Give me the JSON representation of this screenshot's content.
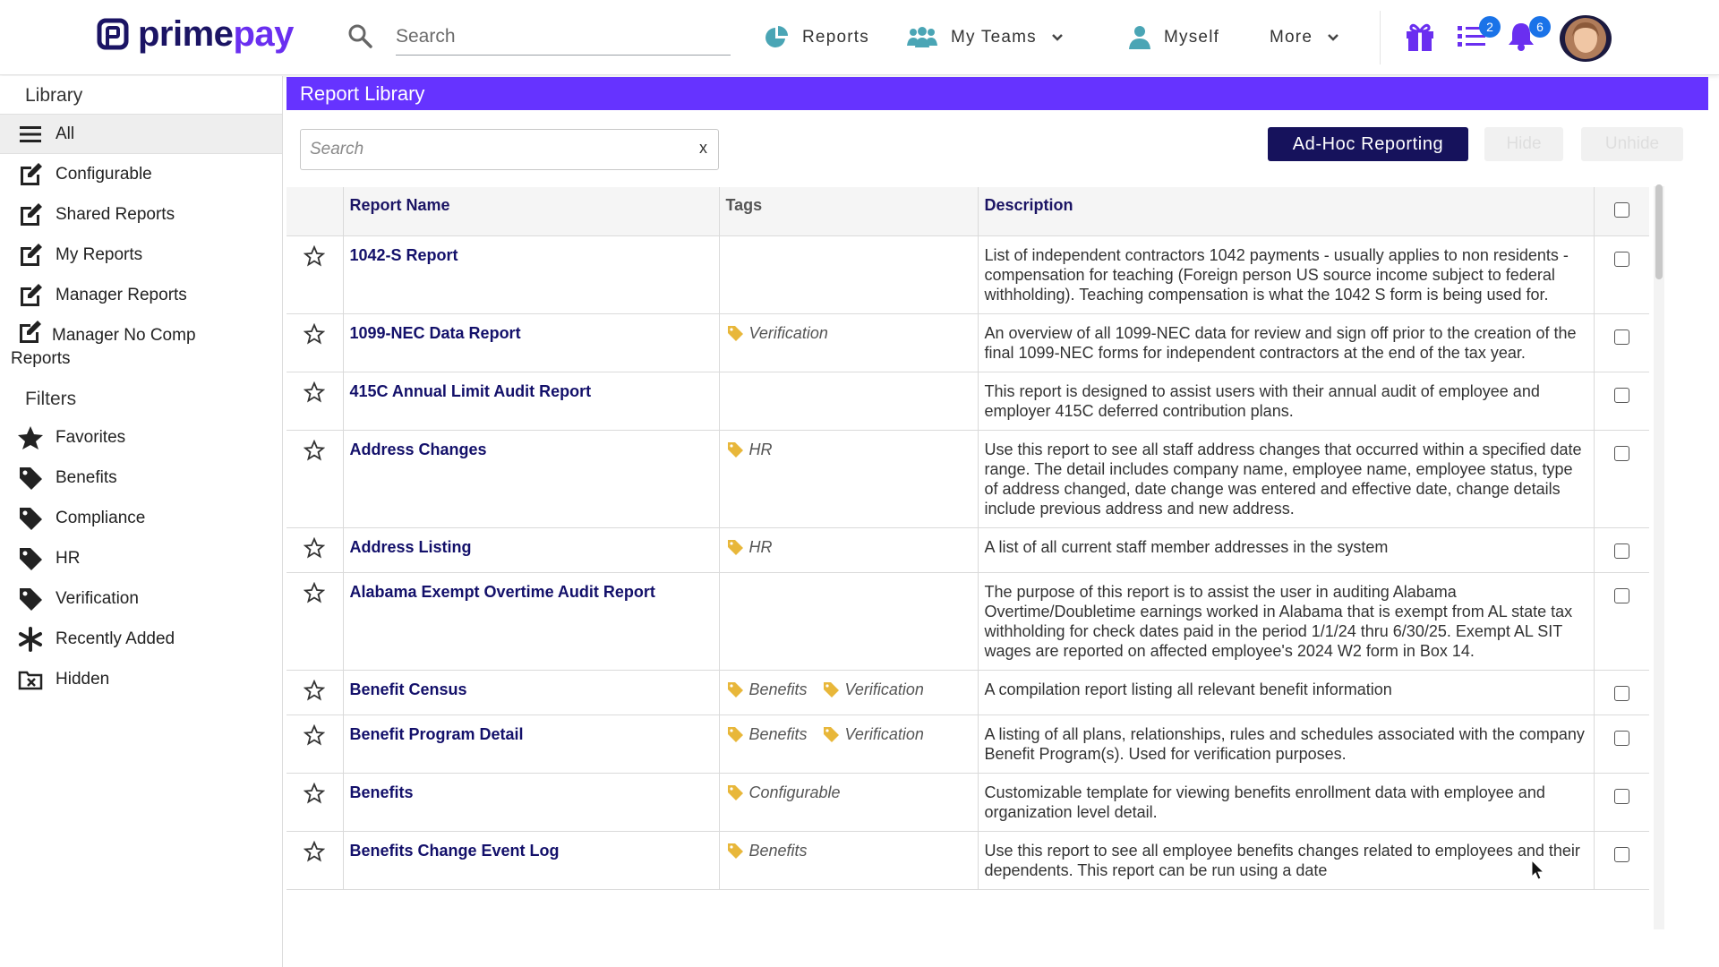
{
  "brand": {
    "prime": "prime",
    "pay": "pay",
    "color_primary": "#1b1464",
    "color_accent": "#6a2ff0"
  },
  "header": {
    "search_placeholder": "Search",
    "nav": [
      {
        "label": "Reports",
        "icon": "pie-chart-icon"
      },
      {
        "label": "My Teams",
        "icon": "team-icon"
      },
      {
        "label": "Myself",
        "icon": "person-icon"
      },
      {
        "label": "More",
        "icon": "chevron-down-icon"
      }
    ],
    "tasks_count": "2",
    "notifications_count": "6"
  },
  "sidebar": {
    "library_heading": "Library",
    "library_items": [
      {
        "label": "All",
        "icon": "menu-icon"
      },
      {
        "label": "Configurable",
        "icon": "edit-icon"
      },
      {
        "label": "Shared Reports",
        "icon": "edit-icon"
      },
      {
        "label": "My Reports",
        "icon": "edit-icon"
      },
      {
        "label": "Manager Reports",
        "icon": "edit-icon"
      },
      {
        "label": "Manager No Comp Reports",
        "icon": "edit-icon"
      }
    ],
    "filters_heading": "Filters",
    "filter_items": [
      {
        "label": "Favorites",
        "icon": "star-icon"
      },
      {
        "label": "Benefits",
        "icon": "tag-icon"
      },
      {
        "label": "Compliance",
        "icon": "tag-icon"
      },
      {
        "label": "HR",
        "icon": "tag-icon"
      },
      {
        "label": "Verification",
        "icon": "tag-icon"
      },
      {
        "label": "Recently Added",
        "icon": "asterisk-icon"
      },
      {
        "label": "Hidden",
        "icon": "hidden-folder-icon"
      }
    ]
  },
  "main": {
    "title": "Report Library",
    "title_bar_color": "#6633ff",
    "search_placeholder": "Search",
    "search_clear": "x",
    "adhoc_label": "Ad-Hoc Reporting",
    "hide_label": "Hide",
    "unhide_label": "Unhide",
    "columns": {
      "name": "Report Name",
      "tags": "Tags",
      "description": "Description"
    },
    "rows": [
      {
        "name": "1042-S Report",
        "tags": [],
        "description": "List of independent contractors 1042 payments - usually applies to non residents - compensation for teaching (Foreign person US source income subject to federal withholding). Teaching compensation is what the 1042 S form is being used for."
      },
      {
        "name": "1099-NEC Data Report",
        "tags": [
          "Verification"
        ],
        "description": "An overview of all 1099-NEC data for review and sign off prior to the creation of the final 1099-NEC forms for independent contractors at the end of the tax year."
      },
      {
        "name": "415C Annual Limit Audit Report",
        "tags": [],
        "description": "This report is designed to assist users with their annual audit of employee and employer 415C deferred contribution plans."
      },
      {
        "name": "Address Changes",
        "tags": [
          "HR"
        ],
        "description": "Use this report to see all staff address changes that occurred within a specified date range. The detail includes company name, employee name, employee status, type of address changed, date change was entered and effective date, change details include previous address and new address."
      },
      {
        "name": "Address Listing",
        "tags": [
          "HR"
        ],
        "description": "A list of all current staff member addresses in the system"
      },
      {
        "name": "Alabama Exempt Overtime Audit Report",
        "tags": [],
        "description": "The purpose of this report is to assist the user in auditing Alabama Overtime/Doubletime earnings worked in Alabama that is exempt from AL state tax withholding for check dates paid in the period 1/1/24 thru 6/30/25. Exempt AL SIT wages are reported on affected employee's 2024 W2 form in Box 14."
      },
      {
        "name": "Benefit Census",
        "tags": [
          "Benefits",
          "Verification"
        ],
        "description": "A compilation report listing all relevant benefit information"
      },
      {
        "name": "Benefit Program Detail",
        "tags": [
          "Benefits",
          "Verification"
        ],
        "description": "A listing of all plans, relationships, rules and schedules associated with the company Benefit Program(s). Used for verification purposes."
      },
      {
        "name": "Benefits",
        "tags": [
          "Configurable"
        ],
        "description": "Customizable template for viewing benefits enrollment data with employee and organization level detail."
      },
      {
        "name": "Benefits Change Event Log",
        "tags": [
          "Benefits"
        ],
        "description": "Use this report to see all employee benefits changes related to employees and their dependents. This report can be run using a date"
      }
    ]
  },
  "colors": {
    "tag": "#e8b73a",
    "link": "#13106a",
    "button_dark": "#16125c",
    "badge": "#1a73e8"
  }
}
